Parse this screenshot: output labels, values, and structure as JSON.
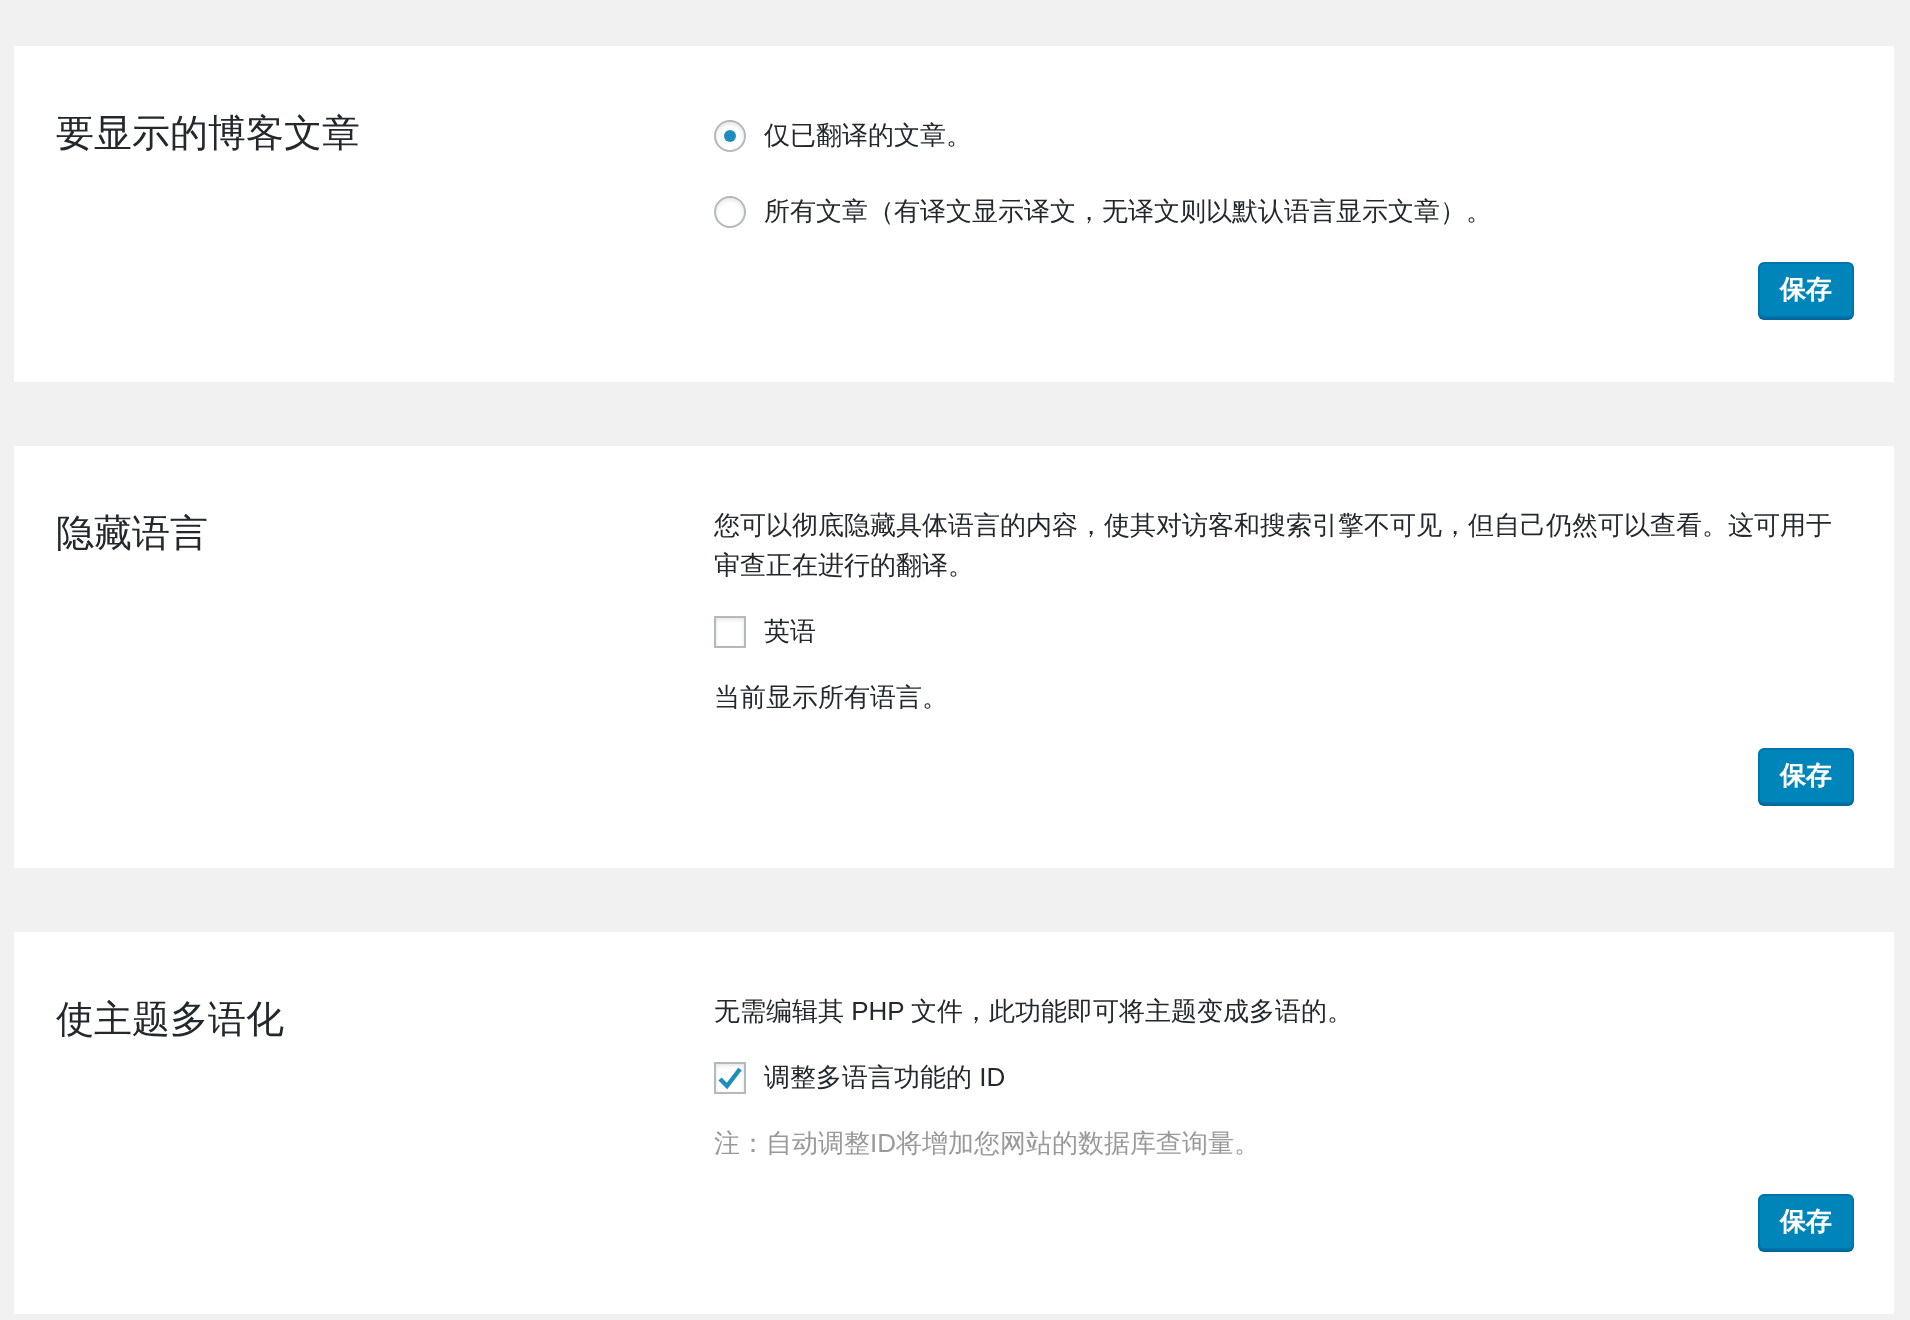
{
  "sections": [
    {
      "title": "要显示的博客文章",
      "items": [
        {
          "kind": "radio",
          "label": "仅已翻译的文章。",
          "selected": true
        },
        {
          "kind": "radio",
          "label": "所有文章（有译文显示译文，无译文则以默认语言显示文章）。",
          "selected": false
        }
      ],
      "button": "保存"
    },
    {
      "title": "隐藏语言",
      "items": [
        {
          "kind": "text",
          "text": "您可以彻底隐藏具体语言的内容，使其对访客和搜索引擎不可见，但自己仍然可以查看。这可用于审查正在进行的翻译。"
        },
        {
          "kind": "checkbox",
          "label": "英语",
          "checked": false
        },
        {
          "kind": "text",
          "text": "当前显示所有语言。"
        }
      ],
      "button": "保存"
    },
    {
      "title": "使主题多语化",
      "items": [
        {
          "kind": "text",
          "text": "无需编辑其 PHP 文件，此功能即可将主题变成多语的。"
        },
        {
          "kind": "checkbox",
          "label": "调整多语言功能的 ID",
          "checked": true
        },
        {
          "kind": "note",
          "text": "注：自动调整ID将增加您网站的数据库查询量。"
        }
      ],
      "button": "保存"
    }
  ]
}
